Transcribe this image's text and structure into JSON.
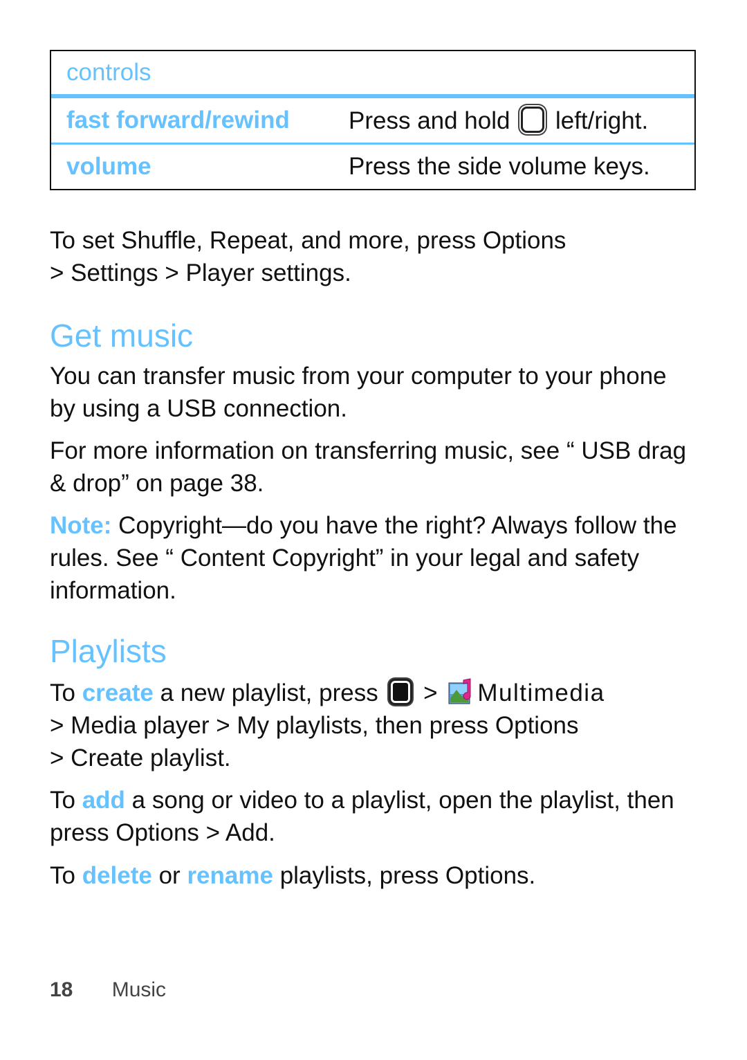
{
  "controls_table": {
    "header": "controls",
    "rows": [
      {
        "key": "fast forward/rewind",
        "value_before": "Press and hold",
        "icon": "nav-key-icon",
        "value_after": "left/right."
      },
      {
        "key": "volume",
        "value": "Press the side volume keys."
      }
    ]
  },
  "settings_paragraph": {
    "text1": "To set Shuffle, Repeat, and more, press Options",
    "text2": "> Settings > Player settings."
  },
  "get_music": {
    "heading": "Get music",
    "para1": "You can transfer music from your computer to your phone by using a USB connection.",
    "para2": "For more information on transferring music, see “ USB drag & drop” on page 38.",
    "note_label": "Note:",
    "note_text": " Copyright—do you have the right? Always follow the rules. See “ Content Copyright” in your legal and safety information."
  },
  "playlists": {
    "heading": "Playlists",
    "create": {
      "prefix": "To ",
      "keyword": "create",
      "text1": " a new playlist, press ",
      "sep": " > ",
      "menu1": "Multimedia",
      "text2": "> Media player > My playlists, then press Options",
      "text3": "> Create playlist."
    },
    "add": {
      "prefix": "To ",
      "keyword": "add",
      "text": " a song or video to a playlist, open the playlist, then press Options > Add."
    },
    "delete": {
      "prefix": "To ",
      "keyword1": "delete",
      "mid": " or ",
      "keyword2": "rename",
      "text": " playlists, press Options."
    }
  },
  "footer": {
    "page_number": "18",
    "section": "Music"
  },
  "colors": {
    "accent": "#66c2ff",
    "text": "#111111"
  }
}
